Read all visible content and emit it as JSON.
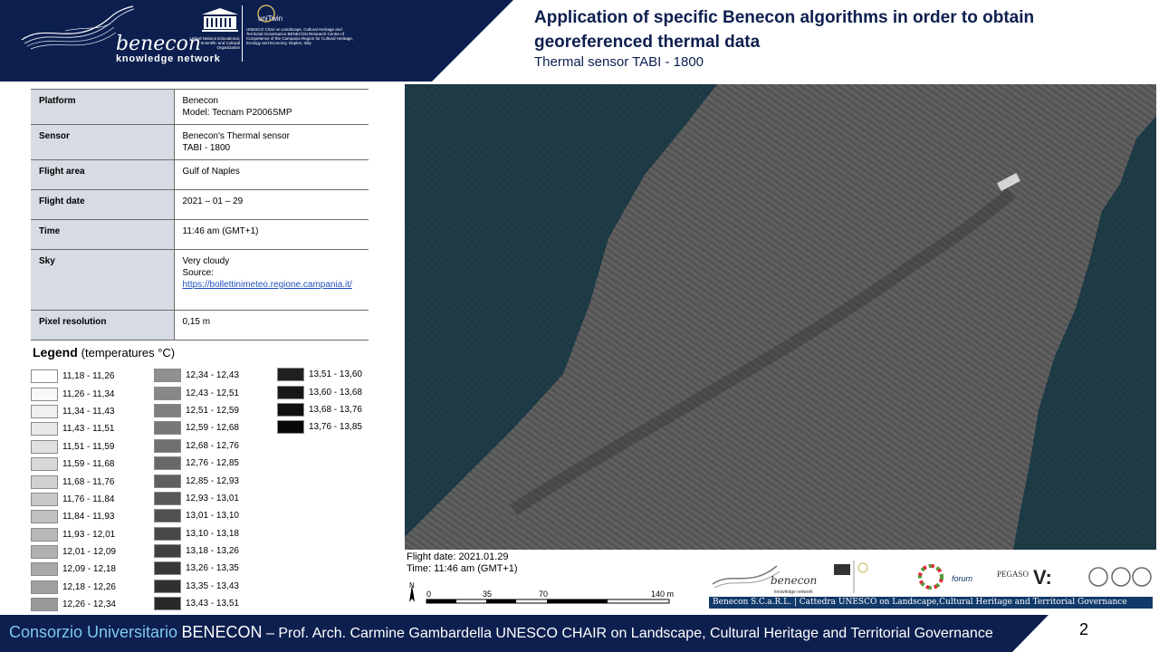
{
  "header": {
    "logo_name": "benecon",
    "logo_subtitle": "knowledge network",
    "unesco_caption": "United Nations Educational, Scientific and Cultural Organization",
    "unitwin_label": "uniTwin",
    "unitwin_caption": "UNESCO Chair on Landscape, Cultural Heritage and Territorial Governance BENECON Research Centre of Competence of the Campania Region for Cultural Heritage, Ecology and Economy, Naples, Italy",
    "title": "Application of specific Benecon algorithms in order to obtain georeferenced thermal data",
    "subtitle": "Thermal sensor TABI - 1800",
    "banner_color": "#0d1f4f"
  },
  "info_table": [
    {
      "key": "Platform",
      "value_lines": [
        "Benecon",
        "Model: Tecnam P2006SMP"
      ]
    },
    {
      "key": "Sensor",
      "value_lines": [
        "Benecon's Thermal sensor",
        "TABI - 1800"
      ]
    },
    {
      "key": "Flight area",
      "value_lines": [
        "Gulf of Naples"
      ]
    },
    {
      "key": "Flight date",
      "value_lines": [
        "2021 – 01 – 29"
      ]
    },
    {
      "key": "Time",
      "value_lines": [
        "11:46 am (GMT+1)"
      ]
    },
    {
      "key": "Sky",
      "value_lines": [
        "Very cloudy",
        "Source:"
      ],
      "link": "https://bollettinimeteo.regione.campania.it/"
    },
    {
      "key": "Pixel resolution",
      "value_lines": [
        "0,15 m"
      ]
    }
  ],
  "legend": {
    "title": "Legend",
    "unit": "(temperatures °C)",
    "items": [
      {
        "label": "11,18 - 11,26",
        "color": "#ffffff"
      },
      {
        "label": "11,26 - 11,34",
        "color": "#f8f8f8"
      },
      {
        "label": "11,34 - 11,43",
        "color": "#f0f0f0"
      },
      {
        "label": "11,43 - 11,51",
        "color": "#e8e8e8"
      },
      {
        "label": "11,51 - 11,59",
        "color": "#e0e0e0"
      },
      {
        "label": "11,59 - 11,68",
        "color": "#d8d8d8"
      },
      {
        "label": "11,68 - 11,76",
        "color": "#d0d0d0"
      },
      {
        "label": "11,76 - 11,84",
        "color": "#c8c8c8"
      },
      {
        "label": "11,84 - 11,93",
        "color": "#c0c0c0"
      },
      {
        "label": "11,93 - 12,01",
        "color": "#b8b8b8"
      },
      {
        "label": "12,01 - 12,09",
        "color": "#b0b0b0"
      },
      {
        "label": "12,09 - 12,18",
        "color": "#a8a8a8"
      },
      {
        "label": "12,18 - 12,26",
        "color": "#a0a0a0"
      },
      {
        "label": "12,26 - 12,34",
        "color": "#989898"
      },
      {
        "label": "12,34 - 12,43",
        "color": "#909090"
      },
      {
        "label": "12,43 - 12,51",
        "color": "#888888"
      },
      {
        "label": "12,51 - 12,59",
        "color": "#808080"
      },
      {
        "label": "12,59 - 12,68",
        "color": "#787878"
      },
      {
        "label": "12,68 - 12,76",
        "color": "#707070"
      },
      {
        "label": "12,76 - 12,85",
        "color": "#686868"
      },
      {
        "label": "12,85 - 12,93",
        "color": "#606060"
      },
      {
        "label": "12,93 - 13,01",
        "color": "#585858"
      },
      {
        "label": "13,01 - 13,10",
        "color": "#505050"
      },
      {
        "label": "13,10 - 13,18",
        "color": "#484848"
      },
      {
        "label": "13,18 - 13,26",
        "color": "#404040"
      },
      {
        "label": "13,26 - 13,35",
        "color": "#383838"
      },
      {
        "label": "13,35 - 13,43",
        "color": "#303030"
      },
      {
        "label": "13,43 - 13,51",
        "color": "#282828"
      },
      {
        "label": "13,51 - 13,60",
        "color": "#202020"
      },
      {
        "label": "13,60 - 13,68",
        "color": "#181818"
      },
      {
        "label": "13,68 - 13,76",
        "color": "#101010"
      },
      {
        "label": "13,76 - 13,85",
        "color": "#080808"
      }
    ]
  },
  "map": {
    "caption_date": "Flight date: 2021.01.29",
    "caption_time": "Time: 11:46 am (GMT+1)",
    "north_label": "N",
    "scale_ticks": [
      "0",
      "35",
      "70",
      "140 m"
    ],
    "sea_color": "#1d3a45"
  },
  "logos": {
    "forum_label": "forum",
    "pegaso_label": "PEGASO",
    "footer_strip": "Benecon S.C.a.R.L. | Cattedra UNESCO on Landscape,Cultural Heritage and Territorial Governance"
  },
  "footer": {
    "consortium": "Consorzio Universitario",
    "benecon": "BENECON",
    "rest": " – Prof. Arch. Carmine Gambardella UNESCO CHAIR on Landscape, Cultural Heritage and Territorial Governance",
    "page_number": "2",
    "bar_color": "#0d1f4f"
  }
}
